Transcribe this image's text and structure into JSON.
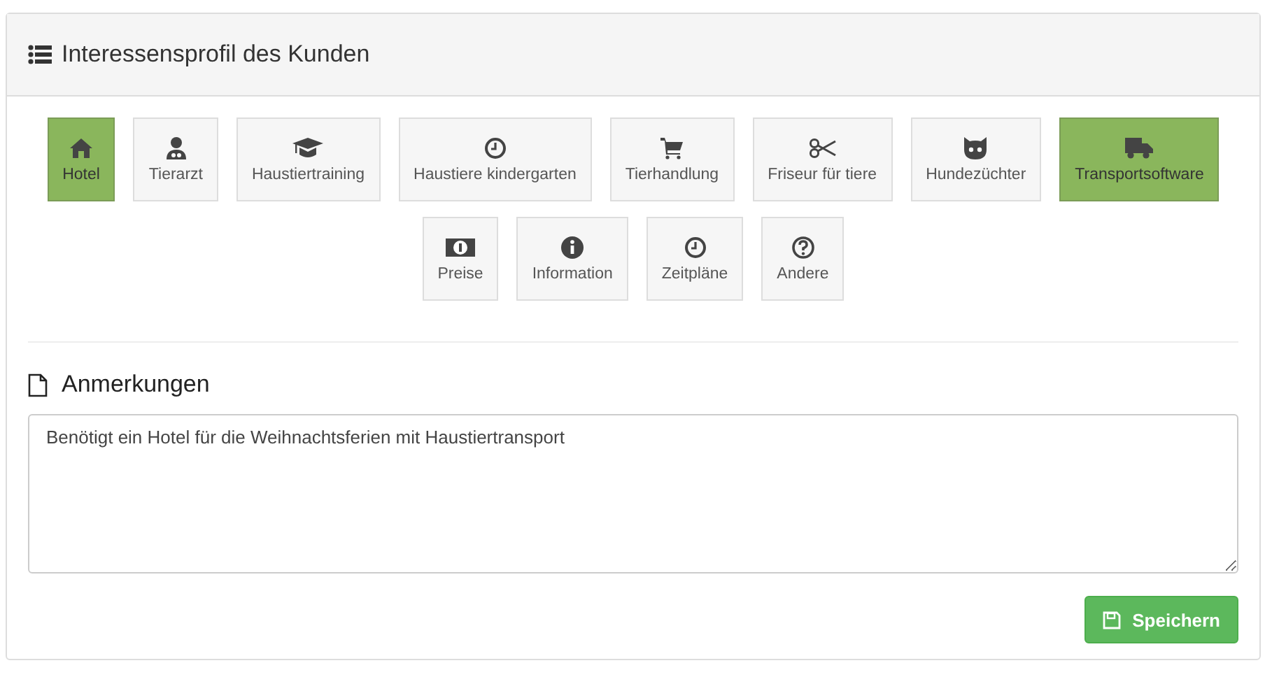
{
  "panel": {
    "title": "Interessensprofil des Kunden"
  },
  "interests": [
    {
      "label": "Hotel",
      "selected": true
    },
    {
      "label": "Tierarzt",
      "selected": false
    },
    {
      "label": "Haustiertraining",
      "selected": false
    },
    {
      "label": "Haustiere kindergarten",
      "selected": false
    },
    {
      "label": "Tierhandlung",
      "selected": false
    },
    {
      "label": "Friseur für tiere",
      "selected": false
    },
    {
      "label": "Hundezüchter",
      "selected": false
    },
    {
      "label": "Transportsoftware",
      "selected": true
    },
    {
      "label": "Preise",
      "selected": false
    },
    {
      "label": "Information",
      "selected": false
    },
    {
      "label": "Zeitpläne",
      "selected": false
    },
    {
      "label": "Andere",
      "selected": false
    }
  ],
  "notes": {
    "heading": "Anmerkungen",
    "value": "Benötigt ein Hotel für die Weihnachtsferien mit Haustiertransport"
  },
  "buttons": [
    {
      "label": "Speichern"
    }
  ]
}
